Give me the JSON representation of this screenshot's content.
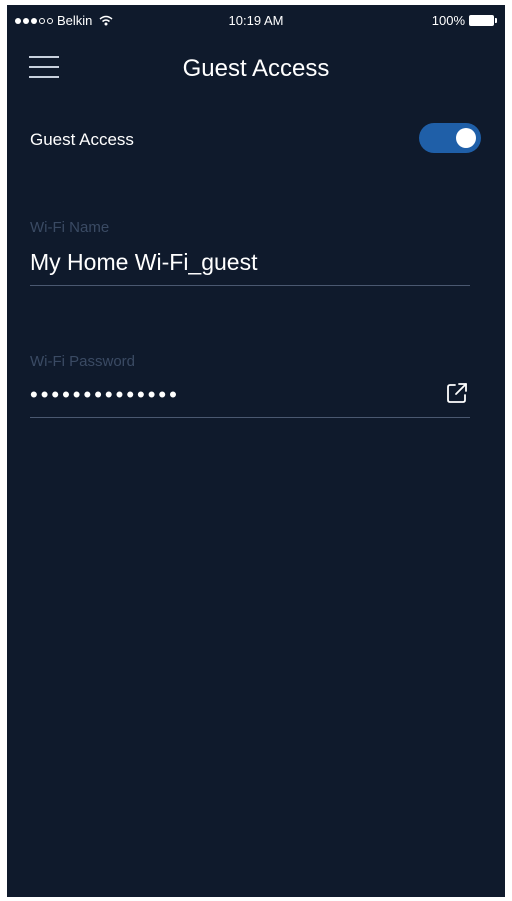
{
  "status_bar": {
    "carrier": "Belkin",
    "time": "10:19 AM",
    "battery": "100%"
  },
  "header": {
    "title": "Guest Access",
    "menu_icon": "hamburger-menu-icon"
  },
  "guest_access": {
    "label": "Guest Access",
    "enabled": true
  },
  "wifi_name": {
    "label": "Wi-Fi  Name",
    "value": "My Home Wi-Fi_guest"
  },
  "wifi_password": {
    "label": "Wi-Fi Password",
    "masked_value": "••••••••••••••",
    "share_icon": "share-icon"
  },
  "colors": {
    "background": "#0f1a2c",
    "toggle_on": "#1f5fa8",
    "label_muted": "#3a4a63",
    "divider": "#4a5870"
  }
}
